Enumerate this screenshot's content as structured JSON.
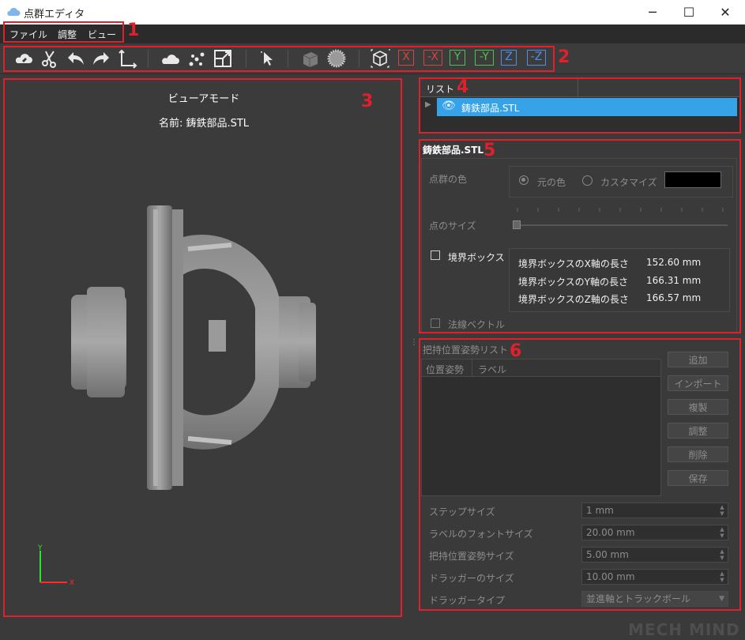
{
  "window": {
    "title": "点群エディタ",
    "minimize": "─",
    "maximize": "☐",
    "close": "✕"
  },
  "menu": {
    "items": [
      "ファイル",
      "調整",
      "ビュー"
    ]
  },
  "toolbar": {
    "icons": [
      "cloud-open-icon",
      "cut-icon",
      "undo-icon",
      "redo-icon",
      "axes-icon",
      "cloud-icon",
      "points-icon",
      "scale-icon",
      "select-icon",
      "solid-icon",
      "sphere-icon",
      "cube-view-icon"
    ],
    "axis_buttons": [
      {
        "label": "X",
        "color": "#e0403a"
      },
      {
        "label": "-X",
        "color": "#e0403a"
      },
      {
        "label": "Y",
        "color": "#4ec04e"
      },
      {
        "label": "-Y",
        "color": "#4ec04e"
      },
      {
        "label": "Z",
        "color": "#4a8ef0"
      },
      {
        "label": "-Z",
        "color": "#4a8ef0"
      }
    ]
  },
  "viewer": {
    "mode": "ビューアモード",
    "name": "名前: 鋳鉄部品.STL",
    "axis_y": "Y",
    "axis_x": "X"
  },
  "list": {
    "header": "リスト",
    "item": "鋳鉄部品.STL"
  },
  "props": {
    "title": "鋳鉄部品.STL",
    "point_color_label": "点群の色",
    "original_color": "元の色",
    "custom": "カスタマイズ",
    "custom_color": "#000000",
    "point_size_label": "点のサイズ",
    "bbox_label": "境界ボックス",
    "bbox_rows": [
      {
        "label": "境界ボックスのX軸の長さ",
        "value": "152.60  mm"
      },
      {
        "label": "境界ボックスのY軸の長さ",
        "value": "166.31  mm"
      },
      {
        "label": "境界ボックスのZ軸の長さ",
        "value": "166.57  mm"
      }
    ],
    "normal_label": "法線ベクトル"
  },
  "grip": {
    "title": "把持位置姿勢リスト",
    "col_pose": "位置姿勢",
    "col_label": "ラベル",
    "buttons": [
      "追加",
      "インポート",
      "複製",
      "調整",
      "削除",
      "保存"
    ],
    "fields": [
      {
        "label": "ステップサイズ",
        "value": "1 mm"
      },
      {
        "label": "ラベルのフォントサイズ",
        "value": "20.00 mm"
      },
      {
        "label": "把持位置姿勢サイズ",
        "value": "5.00 mm"
      },
      {
        "label": "ドラッガーのサイズ",
        "value": "10.00 mm"
      }
    ],
    "dragger_type_label": "ドラッガータイプ",
    "dragger_type_value": "並進軸とトラックボール"
  },
  "annotations": [
    "1",
    "2",
    "3",
    "4",
    "5",
    "6"
  ],
  "watermark": "MECH MIND"
}
